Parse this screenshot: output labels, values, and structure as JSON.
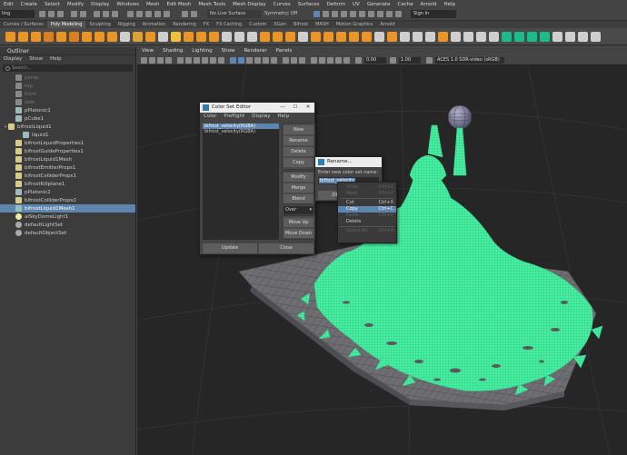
{
  "menubar": [
    "Edit",
    "Create",
    "Select",
    "Modify",
    "Display",
    "Windows",
    "Mesh",
    "Edit Mesh",
    "Mesh Tools",
    "Mesh Display",
    "Curves",
    "Surfaces",
    "Deform",
    "UV",
    "Generate",
    "Cache",
    "Arnold",
    "Help"
  ],
  "status": {
    "mode": "ling",
    "live_surface": "No Live Surface",
    "symmetry": "Symmetry: Off",
    "sign_in": "Sign In"
  },
  "shelf_tabs": [
    "Curves / Surfaces",
    "Poly Modeling",
    "Sculpting",
    "Rigging",
    "Animation",
    "Rendering",
    "FX",
    "FX Caching",
    "Custom",
    "XGen",
    "Bifrost",
    "MASH",
    "Motion Graphics",
    "Arnold"
  ],
  "active_shelf_tab": "Poly Modeling",
  "shelf_icon_colors": [
    "#e8962a",
    "#e8962a",
    "#e8962a",
    "#d77f25",
    "#e8962a",
    "#d77f25",
    "#e8962a",
    "#e8962a",
    "#e8962a",
    "#cfcfcf",
    "#d9a23a",
    "#e8962a",
    "#cfcfcf",
    "#f0c040",
    "#e8962a",
    "#e8962a",
    "#e8962a",
    "#cfcfcf",
    "#cfcfcf",
    "#cfcfcf",
    "#e8962a",
    "#e8962a",
    "#e8962a",
    "#cfcfcf",
    "#e8962a",
    "#e8962a",
    "#e8962a",
    "#e8962a",
    "#e8962a",
    "#cfcfcf",
    "#e8962a",
    "#cfcfcf",
    "#cfcfcf",
    "#cfcfcf",
    "#e8962a",
    "#cfcfcf",
    "#cfcfcf",
    "#cfcfcf",
    "#cfcfcf",
    "#1fb98a",
    "#1fb98a",
    "#1fb98a",
    "#1fb98a",
    "#cfcfcf",
    "#cfcfcf",
    "#cfcfcf",
    "#cfcfcf"
  ],
  "outliner": {
    "title": "Outliner",
    "menu": [
      "Display",
      "Show",
      "Help"
    ],
    "search_placeholder": "Search...",
    "items": [
      {
        "label": "persp",
        "icon": "cam",
        "dim": true,
        "indent": 1
      },
      {
        "label": "top",
        "icon": "cam",
        "dim": true,
        "indent": 1
      },
      {
        "label": "front",
        "icon": "cam",
        "dim": true,
        "indent": 1
      },
      {
        "label": "side",
        "icon": "cam",
        "dim": true,
        "indent": 1
      },
      {
        "label": "pPlatonic1",
        "icon": "mesh",
        "indent": 1
      },
      {
        "label": "pCube1",
        "icon": "mesh",
        "indent": 1
      },
      {
        "label": "bifrostLiquid1",
        "icon": "bif",
        "indent": 0,
        "expand": "+"
      },
      {
        "label": "liquid1",
        "icon": "mesh",
        "indent": 2
      },
      {
        "label": "bifrostLiquidProperties1",
        "icon": "bif",
        "indent": 1
      },
      {
        "label": "bifrostGuideProperties1",
        "icon": "bif",
        "indent": 1
      },
      {
        "label": "bifrostLiquid1Mesh",
        "icon": "bif",
        "indent": 1
      },
      {
        "label": "bifrostEmitterProps1",
        "icon": "bif",
        "indent": 1
      },
      {
        "label": "bifrostColliderProps1",
        "icon": "bif",
        "indent": 1
      },
      {
        "label": "bifrostKillplane1",
        "icon": "bif",
        "indent": 1
      },
      {
        "label": "pPlatonic2",
        "icon": "mesh",
        "indent": 1
      },
      {
        "label": "bifrostColliderProps2",
        "icon": "bif",
        "indent": 1
      },
      {
        "label": "bifrostLiquid1Mesh1",
        "icon": "mesh",
        "indent": 1,
        "selected": true
      },
      {
        "label": "aiSkyDomeLight1",
        "icon": "light",
        "indent": 1
      },
      {
        "label": "defaultLightSet",
        "icon": "set",
        "indent": 1
      },
      {
        "label": "defaultObjectSet",
        "icon": "set",
        "indent": 1
      }
    ]
  },
  "viewport": {
    "menu": [
      "View",
      "Shading",
      "Lighting",
      "Show",
      "Renderer",
      "Panels"
    ],
    "field1": "0.00",
    "field2": "1.00",
    "colorspace": "ACES 1.0 SDR-video (sRGB)"
  },
  "color_set_editor": {
    "title": "Color Set Editor",
    "menu": [
      "Color",
      "Preflight",
      "Display",
      "Help"
    ],
    "sets": [
      "bifrost_velocity(RGBA)",
      "bifrost_velocity(RGBA)"
    ],
    "buttons_top": [
      "New",
      "Rename",
      "Delete",
      "Copy"
    ],
    "buttons_mid": [
      "Modify",
      "Merge",
      "Blend"
    ],
    "blend_mode": "Over",
    "buttons_bottom": [
      "Move Up",
      "Move Down"
    ],
    "update": "Update",
    "close": "Close"
  },
  "rename_dialog": {
    "title": "Rename...",
    "prompt": "Enter new color set name:",
    "value": "bifrost_velocity",
    "ok": "OK"
  },
  "context_menu": [
    {
      "label": "Undo",
      "shortcut": "Ctrl+Z",
      "disabled": true
    },
    {
      "label": "Redo",
      "shortcut": "Ctrl+Y",
      "disabled": true
    },
    {
      "sep": true
    },
    {
      "label": "Cut",
      "shortcut": "Ctrl+X"
    },
    {
      "label": "Copy",
      "shortcut": "Ctrl+C",
      "highlight": true
    },
    {
      "label": "Paste",
      "shortcut": "Ctrl+V",
      "disabled": true
    },
    {
      "label": "Delete",
      "shortcut": ""
    },
    {
      "sep": true
    },
    {
      "label": "Select All",
      "shortcut": "Ctrl+A",
      "disabled": true
    }
  ],
  "colors": {
    "liquid": "#45f0a0",
    "selection": "#5d85ad",
    "ground": "#6e6e72"
  }
}
